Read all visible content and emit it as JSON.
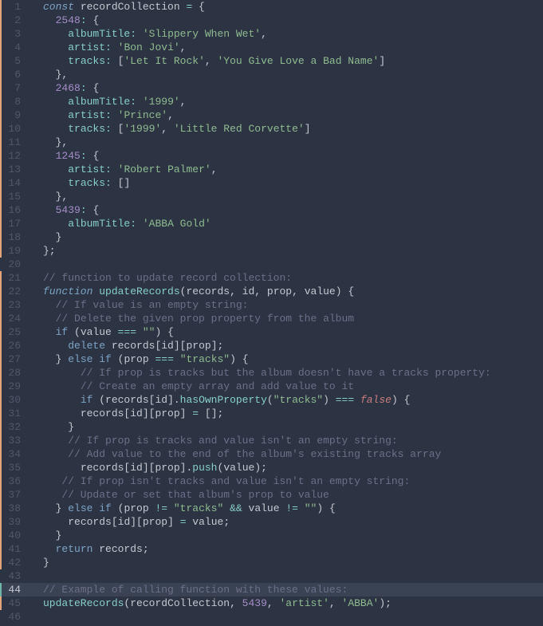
{
  "lines": [
    {
      "n": 1,
      "m": "mod",
      "t": [
        [
          "kw",
          "const "
        ],
        [
          "id",
          "recordCollection "
        ],
        [
          "op",
          "= "
        ],
        [
          "punc",
          "{"
        ]
      ]
    },
    {
      "n": 2,
      "m": "mod",
      "t": [
        [
          "def",
          "  "
        ],
        [
          "num",
          "2548"
        ],
        [
          "op",
          ":"
        ],
        [
          "punc",
          " {"
        ]
      ]
    },
    {
      "n": 3,
      "m": "mod",
      "t": [
        [
          "def",
          "    "
        ],
        [
          "prop",
          "albumTitle"
        ],
        [
          "op",
          ":"
        ],
        [
          "def",
          " "
        ],
        [
          "str",
          "'Slippery When Wet'"
        ],
        [
          "punc",
          ","
        ]
      ]
    },
    {
      "n": 4,
      "m": "mod",
      "t": [
        [
          "def",
          "    "
        ],
        [
          "prop",
          "artist"
        ],
        [
          "op",
          ":"
        ],
        [
          "def",
          " "
        ],
        [
          "str",
          "'Bon Jovi'"
        ],
        [
          "punc",
          ","
        ]
      ]
    },
    {
      "n": 5,
      "m": "mod",
      "t": [
        [
          "def",
          "    "
        ],
        [
          "prop",
          "tracks"
        ],
        [
          "op",
          ":"
        ],
        [
          "def",
          " ["
        ],
        [
          "str",
          "'Let It Rock'"
        ],
        [
          "punc",
          ", "
        ],
        [
          "str",
          "'You Give Love a Bad Name'"
        ],
        [
          "punc",
          "]"
        ]
      ]
    },
    {
      "n": 6,
      "m": "mod",
      "t": [
        [
          "def",
          "  "
        ],
        [
          "punc",
          "},"
        ]
      ]
    },
    {
      "n": 7,
      "m": "mod",
      "t": [
        [
          "def",
          "  "
        ],
        [
          "num",
          "2468"
        ],
        [
          "op",
          ":"
        ],
        [
          "punc",
          " {"
        ]
      ]
    },
    {
      "n": 8,
      "m": "mod",
      "t": [
        [
          "def",
          "    "
        ],
        [
          "prop",
          "albumTitle"
        ],
        [
          "op",
          ":"
        ],
        [
          "def",
          " "
        ],
        [
          "str",
          "'1999'"
        ],
        [
          "punc",
          ","
        ]
      ]
    },
    {
      "n": 9,
      "m": "mod",
      "t": [
        [
          "def",
          "    "
        ],
        [
          "prop",
          "artist"
        ],
        [
          "op",
          ":"
        ],
        [
          "def",
          " "
        ],
        [
          "str",
          "'Prince'"
        ],
        [
          "punc",
          ","
        ]
      ]
    },
    {
      "n": 10,
      "m": "mod",
      "t": [
        [
          "def",
          "    "
        ],
        [
          "prop",
          "tracks"
        ],
        [
          "op",
          ":"
        ],
        [
          "def",
          " ["
        ],
        [
          "str",
          "'1999'"
        ],
        [
          "punc",
          ", "
        ],
        [
          "str",
          "'Little Red Corvette'"
        ],
        [
          "punc",
          "]"
        ]
      ]
    },
    {
      "n": 11,
      "m": "mod",
      "t": [
        [
          "def",
          "  "
        ],
        [
          "punc",
          "},"
        ]
      ]
    },
    {
      "n": 12,
      "m": "mod",
      "t": [
        [
          "def",
          "  "
        ],
        [
          "num",
          "1245"
        ],
        [
          "op",
          ":"
        ],
        [
          "punc",
          " {"
        ]
      ]
    },
    {
      "n": 13,
      "m": "mod",
      "t": [
        [
          "def",
          "    "
        ],
        [
          "prop",
          "artist"
        ],
        [
          "op",
          ":"
        ],
        [
          "def",
          " "
        ],
        [
          "str",
          "'Robert Palmer'"
        ],
        [
          "punc",
          ","
        ]
      ]
    },
    {
      "n": 14,
      "m": "mod",
      "t": [
        [
          "def",
          "    "
        ],
        [
          "prop",
          "tracks"
        ],
        [
          "op",
          ":"
        ],
        [
          "def",
          " []"
        ]
      ]
    },
    {
      "n": 15,
      "m": "mod",
      "t": [
        [
          "def",
          "  "
        ],
        [
          "punc",
          "},"
        ]
      ]
    },
    {
      "n": 16,
      "m": "mod",
      "t": [
        [
          "def",
          "  "
        ],
        [
          "num",
          "5439"
        ],
        [
          "op",
          ":"
        ],
        [
          "punc",
          " {"
        ]
      ]
    },
    {
      "n": 17,
      "m": "mod",
      "t": [
        [
          "def",
          "    "
        ],
        [
          "prop",
          "albumTitle"
        ],
        [
          "op",
          ":"
        ],
        [
          "def",
          " "
        ],
        [
          "str",
          "'ABBA Gold'"
        ]
      ]
    },
    {
      "n": 18,
      "m": "mod",
      "t": [
        [
          "def",
          "  "
        ],
        [
          "punc",
          "}"
        ]
      ]
    },
    {
      "n": 19,
      "m": "mod",
      "t": [
        [
          "punc",
          "};"
        ]
      ]
    },
    {
      "n": 20,
      "m": "",
      "t": []
    },
    {
      "n": 21,
      "m": "mod",
      "t": [
        [
          "cmt",
          "// function to update record collection:"
        ]
      ]
    },
    {
      "n": 22,
      "m": "mod",
      "t": [
        [
          "fnkw",
          "function "
        ],
        [
          "fn",
          "updateRecords"
        ],
        [
          "punc",
          "("
        ],
        [
          "par",
          "records"
        ],
        [
          "punc",
          ", "
        ],
        [
          "par",
          "id"
        ],
        [
          "punc",
          ", "
        ],
        [
          "par",
          "prop"
        ],
        [
          "punc",
          ", "
        ],
        [
          "par",
          "value"
        ],
        [
          "punc",
          ") {"
        ]
      ]
    },
    {
      "n": 23,
      "m": "mod",
      "t": [
        [
          "def",
          "  "
        ],
        [
          "cmt",
          "// If value is an empty string:"
        ]
      ]
    },
    {
      "n": 24,
      "m": "mod",
      "t": [
        [
          "def",
          "  "
        ],
        [
          "cmt",
          "// Delete the given prop property from the album"
        ]
      ]
    },
    {
      "n": 25,
      "m": "mod",
      "t": [
        [
          "def",
          "  "
        ],
        [
          "kw2",
          "if "
        ],
        [
          "punc",
          "("
        ],
        [
          "id",
          "value "
        ],
        [
          "op",
          "=== "
        ],
        [
          "str",
          "\"\""
        ],
        [
          "punc",
          ") {"
        ]
      ]
    },
    {
      "n": 26,
      "m": "mod",
      "t": [
        [
          "def",
          "    "
        ],
        [
          "kw2",
          "delete "
        ],
        [
          "id",
          "records"
        ],
        [
          "punc",
          "["
        ],
        [
          "id",
          "id"
        ],
        [
          "punc",
          "]["
        ],
        [
          "id",
          "prop"
        ],
        [
          "punc",
          "];"
        ]
      ]
    },
    {
      "n": 27,
      "m": "mod",
      "t": [
        [
          "def",
          "  "
        ],
        [
          "punc",
          "} "
        ],
        [
          "kw2",
          "else if "
        ],
        [
          "punc",
          "("
        ],
        [
          "id",
          "prop "
        ],
        [
          "op",
          "=== "
        ],
        [
          "str",
          "\"tracks\""
        ],
        [
          "punc",
          ") {"
        ]
      ]
    },
    {
      "n": 28,
      "m": "mod",
      "t": [
        [
          "def",
          "      "
        ],
        [
          "cmt",
          "// If prop is tracks but the album doesn't have a tracks property:"
        ]
      ]
    },
    {
      "n": 29,
      "m": "mod",
      "t": [
        [
          "def",
          "      "
        ],
        [
          "cmt",
          "// Create an empty array and add value to it"
        ]
      ]
    },
    {
      "n": 30,
      "m": "mod",
      "t": [
        [
          "def",
          "      "
        ],
        [
          "kw2",
          "if "
        ],
        [
          "punc",
          "("
        ],
        [
          "id",
          "records"
        ],
        [
          "punc",
          "["
        ],
        [
          "id",
          "id"
        ],
        [
          "punc",
          "]."
        ],
        [
          "fn",
          "hasOwnProperty"
        ],
        [
          "punc",
          "("
        ],
        [
          "str",
          "\"tracks\""
        ],
        [
          "punc",
          ") "
        ],
        [
          "op",
          "=== "
        ],
        [
          "bool",
          "false"
        ],
        [
          "punc",
          ") {"
        ]
      ]
    },
    {
      "n": 31,
      "m": "mod",
      "t": [
        [
          "def",
          "      "
        ],
        [
          "id",
          "records"
        ],
        [
          "punc",
          "["
        ],
        [
          "id",
          "id"
        ],
        [
          "punc",
          "]["
        ],
        [
          "id",
          "prop"
        ],
        [
          "punc",
          "] "
        ],
        [
          "op",
          "= "
        ],
        [
          "punc",
          "[];"
        ]
      ]
    },
    {
      "n": 32,
      "m": "mod",
      "t": [
        [
          "def",
          "    "
        ],
        [
          "punc",
          "}"
        ]
      ]
    },
    {
      "n": 33,
      "m": "mod",
      "t": [
        [
          "def",
          "    "
        ],
        [
          "cmt",
          "// If prop is tracks and value isn't an empty string:"
        ]
      ]
    },
    {
      "n": 34,
      "m": "mod",
      "t": [
        [
          "def",
          "    "
        ],
        [
          "cmt",
          "// Add value to the end of the album's existing tracks array"
        ]
      ]
    },
    {
      "n": 35,
      "m": "mod",
      "t": [
        [
          "def",
          "      "
        ],
        [
          "id",
          "records"
        ],
        [
          "punc",
          "["
        ],
        [
          "id",
          "id"
        ],
        [
          "punc",
          "]["
        ],
        [
          "id",
          "prop"
        ],
        [
          "punc",
          "]."
        ],
        [
          "fn",
          "push"
        ],
        [
          "punc",
          "("
        ],
        [
          "id",
          "value"
        ],
        [
          "punc",
          ");"
        ]
      ]
    },
    {
      "n": 36,
      "m": "mod",
      "t": [
        [
          "def",
          "   "
        ],
        [
          "cmt",
          "// If prop isn't tracks and value isn't an empty string:"
        ]
      ]
    },
    {
      "n": 37,
      "m": "mod",
      "t": [
        [
          "def",
          "   "
        ],
        [
          "cmt",
          "// Update or set that album's prop to value"
        ]
      ]
    },
    {
      "n": 38,
      "m": "mod",
      "t": [
        [
          "def",
          "  "
        ],
        [
          "punc",
          "} "
        ],
        [
          "kw2",
          "else if "
        ],
        [
          "punc",
          "("
        ],
        [
          "id",
          "prop "
        ],
        [
          "op",
          "!= "
        ],
        [
          "str",
          "\"tracks\""
        ],
        [
          "def",
          " "
        ],
        [
          "op",
          "&& "
        ],
        [
          "id",
          "value "
        ],
        [
          "op",
          "!= "
        ],
        [
          "str",
          "\"\""
        ],
        [
          "punc",
          ") {"
        ]
      ]
    },
    {
      "n": 39,
      "m": "mod",
      "t": [
        [
          "def",
          "    "
        ],
        [
          "id",
          "records"
        ],
        [
          "punc",
          "["
        ],
        [
          "id",
          "id"
        ],
        [
          "punc",
          "]["
        ],
        [
          "id",
          "prop"
        ],
        [
          "punc",
          "] "
        ],
        [
          "op",
          "= "
        ],
        [
          "id",
          "value"
        ],
        [
          "punc",
          ";"
        ]
      ]
    },
    {
      "n": 40,
      "m": "mod",
      "t": [
        [
          "def",
          "  "
        ],
        [
          "punc",
          "}"
        ]
      ]
    },
    {
      "n": 41,
      "m": "mod",
      "t": [
        [
          "def",
          "  "
        ],
        [
          "kw2",
          "return "
        ],
        [
          "id",
          "records"
        ],
        [
          "punc",
          ";"
        ]
      ]
    },
    {
      "n": 42,
      "m": "mod",
      "t": [
        [
          "punc",
          "}"
        ]
      ]
    },
    {
      "n": 43,
      "m": "",
      "t": []
    },
    {
      "n": 44,
      "m": "add",
      "cur": true,
      "t": [
        [
          "cmt",
          "// Example of calling function with these values:"
        ]
      ]
    },
    {
      "n": 45,
      "m": "mod",
      "t": [
        [
          "fn",
          "updateRecords"
        ],
        [
          "punc",
          "("
        ],
        [
          "id",
          "recordCollection"
        ],
        [
          "punc",
          ", "
        ],
        [
          "num",
          "5439"
        ],
        [
          "punc",
          ", "
        ],
        [
          "str",
          "'artist'"
        ],
        [
          "punc",
          ", "
        ],
        [
          "str",
          "'ABBA'"
        ],
        [
          "punc",
          ");"
        ]
      ]
    },
    {
      "n": 46,
      "m": "",
      "t": []
    }
  ]
}
